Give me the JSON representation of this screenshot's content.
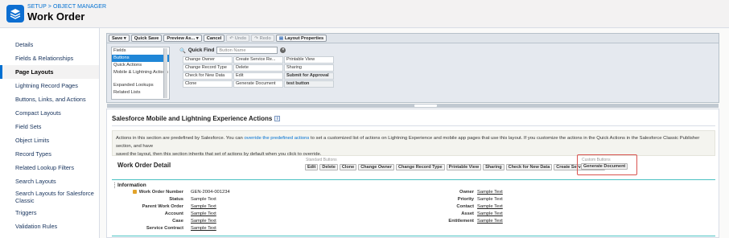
{
  "header": {
    "breadcrumb": "SETUP > OBJECT MANAGER",
    "title": "Work Order",
    "icon": "layers-icon",
    "accent": "#0d6ed1"
  },
  "sidebar": {
    "items": [
      {
        "label": "Details"
      },
      {
        "label": "Fields & Relationships"
      },
      {
        "label": "Page Layouts",
        "active": true
      },
      {
        "label": "Lightning Record Pages"
      },
      {
        "label": "Buttons, Links, and Actions"
      },
      {
        "label": "Compact Layouts"
      },
      {
        "label": "Field Sets"
      },
      {
        "label": "Object Limits"
      },
      {
        "label": "Record Types"
      },
      {
        "label": "Related Lookup Filters"
      },
      {
        "label": "Search Layouts"
      },
      {
        "label": "Search Layouts for Salesforce Classic"
      },
      {
        "label": "Triggers"
      },
      {
        "label": "Validation Rules"
      }
    ]
  },
  "toolbar": {
    "save": "Save",
    "quick_save": "Quick Save",
    "preview_as": "Preview As...",
    "cancel": "Cancel",
    "undo": "Undo",
    "redo": "Redo",
    "layout_properties": "Layout Properties"
  },
  "palette": {
    "items": [
      "Fields",
      "Buttons",
      "Quick Actions",
      "Mobile & Lightning Actions",
      "Expanded Lookups",
      "Related Lists"
    ],
    "selected": "Buttons",
    "quick_find_label": "Quick Find",
    "quick_find_placeholder": "Button Name",
    "grid": [
      [
        "Change Owner",
        "Create Service Re...",
        "Printable View"
      ],
      [
        "Change Record Type",
        "Delete",
        "Sharing"
      ],
      [
        "Check for New Data",
        "Edit",
        "Submit for Approval"
      ],
      [
        "Clone",
        "Generate Document",
        "test button"
      ]
    ]
  },
  "layout": {
    "mobile_title": "Salesforce Mobile and Lightning Experience Actions",
    "desc_before_link": "Actions in this section are predefined by Salesforce. You can ",
    "desc_link": "override the predefined actions",
    "desc_after_link": " to set a customized list of actions on Lightning Experience and mobile app pages that use this layout. If you customize the actions in the Quick Actions in the Salesforce Classic Publisher section, and have",
    "desc_line2": "saved the layout, then this section inherits that set of actions by default when you click to override.",
    "detail_title": "Work Order Detail",
    "standard_label": "Standard Buttons",
    "standard_buttons": [
      "Edit",
      "Delete",
      "Clone",
      "Change Owner",
      "Change Record Type",
      "Printable View",
      "Sharing",
      "Check for New Data",
      "Create Service Report"
    ],
    "custom_label": "Custom Buttons",
    "custom_buttons": [
      "Generate Document"
    ],
    "highlight_color": "#d9534f",
    "section_title": "Information",
    "left_fields": [
      {
        "label": "Work Order Number",
        "value": "GEN-2004-001234",
        "locked": true
      },
      {
        "label": "Status",
        "value": "Sample Text"
      },
      {
        "label": "Parent Work Order",
        "value": "Sample Text",
        "link": true
      },
      {
        "label": "Account",
        "value": "Sample Text",
        "link": true
      },
      {
        "label": "Case",
        "value": "Sample Text",
        "link": true
      },
      {
        "label": "Service Contract",
        "value": "Sample Text",
        "link": true
      }
    ],
    "right_fields": [
      {
        "label": "Owner",
        "value": "Sample Text",
        "link": true
      },
      {
        "label": "Priority",
        "value": "Sample Text"
      },
      {
        "label": "Contact",
        "value": "Sample Text",
        "link": true
      },
      {
        "label": "Asset",
        "value": "Sample Text",
        "link": true
      },
      {
        "label": "Entitlement",
        "value": "Sample Text",
        "link": true
      }
    ]
  }
}
